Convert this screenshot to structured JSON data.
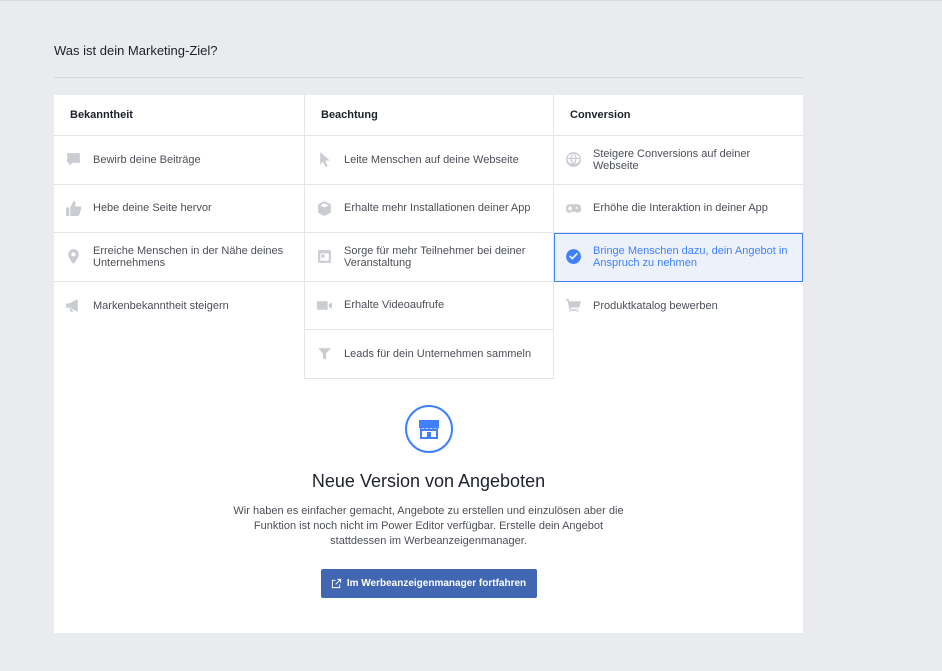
{
  "page": {
    "title": "Was ist dein Marketing-Ziel?"
  },
  "columns": [
    {
      "heading": "Bekanntheit",
      "items": [
        {
          "icon": "speech-bubble-icon",
          "label": "Bewirb deine Beiträge"
        },
        {
          "icon": "thumbs-up-icon",
          "label": "Hebe deine Seite hervor"
        },
        {
          "icon": "location-pin-icon",
          "label": "Erreiche Menschen in der Nähe deines Unternehmens"
        },
        {
          "icon": "megaphone-icon",
          "label": "Markenbekanntheit steigern"
        }
      ]
    },
    {
      "heading": "Beachtung",
      "items": [
        {
          "icon": "cursor-icon",
          "label": "Leite Menschen auf deine Webseite"
        },
        {
          "icon": "box-icon",
          "label": "Erhalte mehr Installationen deiner App"
        },
        {
          "icon": "event-icon",
          "label": "Sorge für mehr Teilnehmer bei deiner Veranstaltung"
        },
        {
          "icon": "video-camera-icon",
          "label": "Erhalte Videoaufrufe"
        },
        {
          "icon": "funnel-icon",
          "label": "Leads für dein Unternehmen sammeln"
        }
      ]
    },
    {
      "heading": "Conversion",
      "items": [
        {
          "icon": "globe-icon",
          "label": "Steigere Conversions auf deiner Webseite"
        },
        {
          "icon": "gamepad-icon",
          "label": "Erhöhe die Interaktion in deiner App"
        },
        {
          "icon": "check-circle-icon",
          "label": "Bringe Menschen dazu, dein Angebot in Anspruch zu nehmen",
          "selected": true
        },
        {
          "icon": "shopping-cart-icon",
          "label": "Produktkatalog bewerben"
        }
      ]
    }
  ],
  "promo": {
    "icon": "storefront-icon",
    "title": "Neue Version von Angeboten",
    "text": "Wir haben es einfacher gemacht, Angebote zu erstellen und einzulösen aber die Funktion ist noch nicht im Power Editor verfügbar. Erstelle dein Angebot stattdessen im Werbeanzeigenmanager.",
    "button_label": "Im Werbeanzeigenmanager fortfahren",
    "button_icon": "external-link-icon"
  },
  "colors": {
    "accent": "#4080ff",
    "button": "#4267b2",
    "background": "#e9ebee",
    "icon_gray": "#c9ccd1"
  }
}
